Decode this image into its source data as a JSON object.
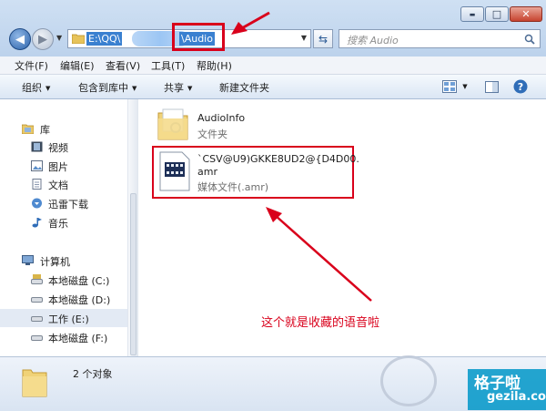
{
  "window": {
    "controls": {
      "minimize": "▬",
      "maximize": "□",
      "close": "✕"
    }
  },
  "toolbar": {
    "address_part1": "E:\\QQ\\",
    "address_part2": "\\Audio",
    "search_placeholder": "搜索 Audio"
  },
  "menubar": [
    "文件(F)",
    "编辑(E)",
    "查看(V)",
    "工具(T)",
    "帮助(H)"
  ],
  "commandbar": {
    "organize": "组织",
    "include_in_library": "包含到库中",
    "share": "共享",
    "new_folder": "新建文件夹"
  },
  "navpane": {
    "libraries_label": "库",
    "libraries": [
      "视频",
      "图片",
      "文档",
      "迅雷下载",
      "音乐"
    ],
    "computer_label": "计算机",
    "drives": [
      "本地磁盘 (C:)",
      "本地磁盘 (D:)",
      "工作 (E:)",
      "本地磁盘 (F:)"
    ],
    "selected_drive": "工作 (E:)"
  },
  "files": [
    {
      "name": "AudioInfo",
      "type": "文件夹",
      "icon": "folder-icon"
    },
    {
      "name_line1": "`CSV@U9)GKKE8UD2@{D4D00.",
      "name_line2": "amr",
      "type": "媒体文件(.amr)",
      "icon": "media-file-icon"
    }
  ],
  "annotation": "这个就是收藏的语音啦",
  "status": {
    "count": "2 个对象"
  },
  "watermark": {
    "brand": "格子啦",
    "domain": "gezila.com"
  },
  "colors": {
    "annotation_red": "#d9001b",
    "selection_blue": "#3a80d0"
  }
}
